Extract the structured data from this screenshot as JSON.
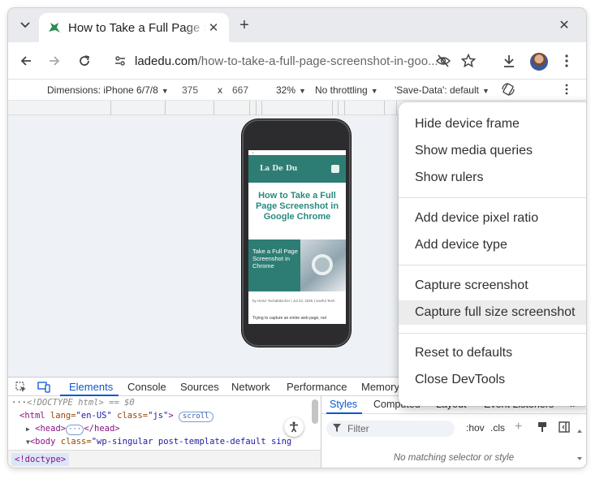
{
  "tab": {
    "title": "How to Take a Full Page Screenshot in Google Chrome",
    "close_label": "✕"
  },
  "new_tab_label": "+",
  "window_close_label": "✕",
  "omnibox": {
    "host": "ladedu.com",
    "path": "/how-to-take-a-full-page-screenshot-in-goo..."
  },
  "device_toolbar": {
    "dimensions_label": "Dimensions: iPhone 6/7/8",
    "width": "375",
    "times": "x",
    "height": "667",
    "zoom": "32%",
    "throttling": "No throttling",
    "save_data": "'Save-Data': default"
  },
  "phone_page": {
    "status": "⌄",
    "logo": "La De Du",
    "title": "How to Take a Full Page Screenshot in Google Chrome",
    "hero_text": "Take a Full Page Screenshot in Chrome",
    "meta": "by Heinz Tschabitscher | Jul 23, 2025 | Useful Tech",
    "body": "Trying to capture an entire web page, not"
  },
  "context_menu": {
    "items": [
      "Hide device frame",
      "Show media queries",
      "Show rulers",
      "Add device pixel ratio",
      "Add device type",
      "Capture screenshot",
      "Capture full size screenshot",
      "Reset to defaults",
      "Close DevTools"
    ],
    "highlighted_index": 6
  },
  "devtools": {
    "tabs": [
      "Elements",
      "Console",
      "Sources",
      "Network",
      "Performance",
      "Memory"
    ],
    "active_tab": "Elements",
    "elements": {
      "line1": {
        "prefix": "···",
        "doctype": "<!DOCTYPE html>",
        "eq": "== $0"
      },
      "line2": {
        "open": "<html",
        "attr1": " lang=",
        "val1": "\"en-US\"",
        "attr2": " class=",
        "val2": "\"js\"",
        "close": ">",
        "badge": "scroll"
      },
      "line3": {
        "arrow": "▶",
        "open": "<head>",
        "ellipsis": "···",
        "close": "</head>"
      },
      "line4": {
        "arrow": "▼",
        "open": "<body",
        "attr": " class=",
        "val": "\"wp-singular post-template-default sing"
      },
      "breadcrumb": "<!doctype>"
    },
    "styles": {
      "tabs": [
        "Styles",
        "Computed",
        "Layout",
        "Event Listeners"
      ],
      "more": "»",
      "filter_placeholder": "Filter",
      "hov": ":hov",
      "cls": ".cls",
      "empty_message": "No matching selector or style"
    }
  },
  "colors": {
    "accent": "#0b57d0",
    "site_teal": "#2e7d74",
    "menu_highlight": "#ececec"
  },
  "icons": [
    "tab-search-icon",
    "favicon-icon",
    "back-icon",
    "forward-icon",
    "reload-icon",
    "site-info-icon",
    "eye-off-icon",
    "star-icon",
    "download-icon",
    "avatar",
    "kebab-menu-icon",
    "rotate-icon",
    "inspect-icon",
    "device-toggle-icon",
    "accessibility-icon",
    "filter-icon"
  ]
}
